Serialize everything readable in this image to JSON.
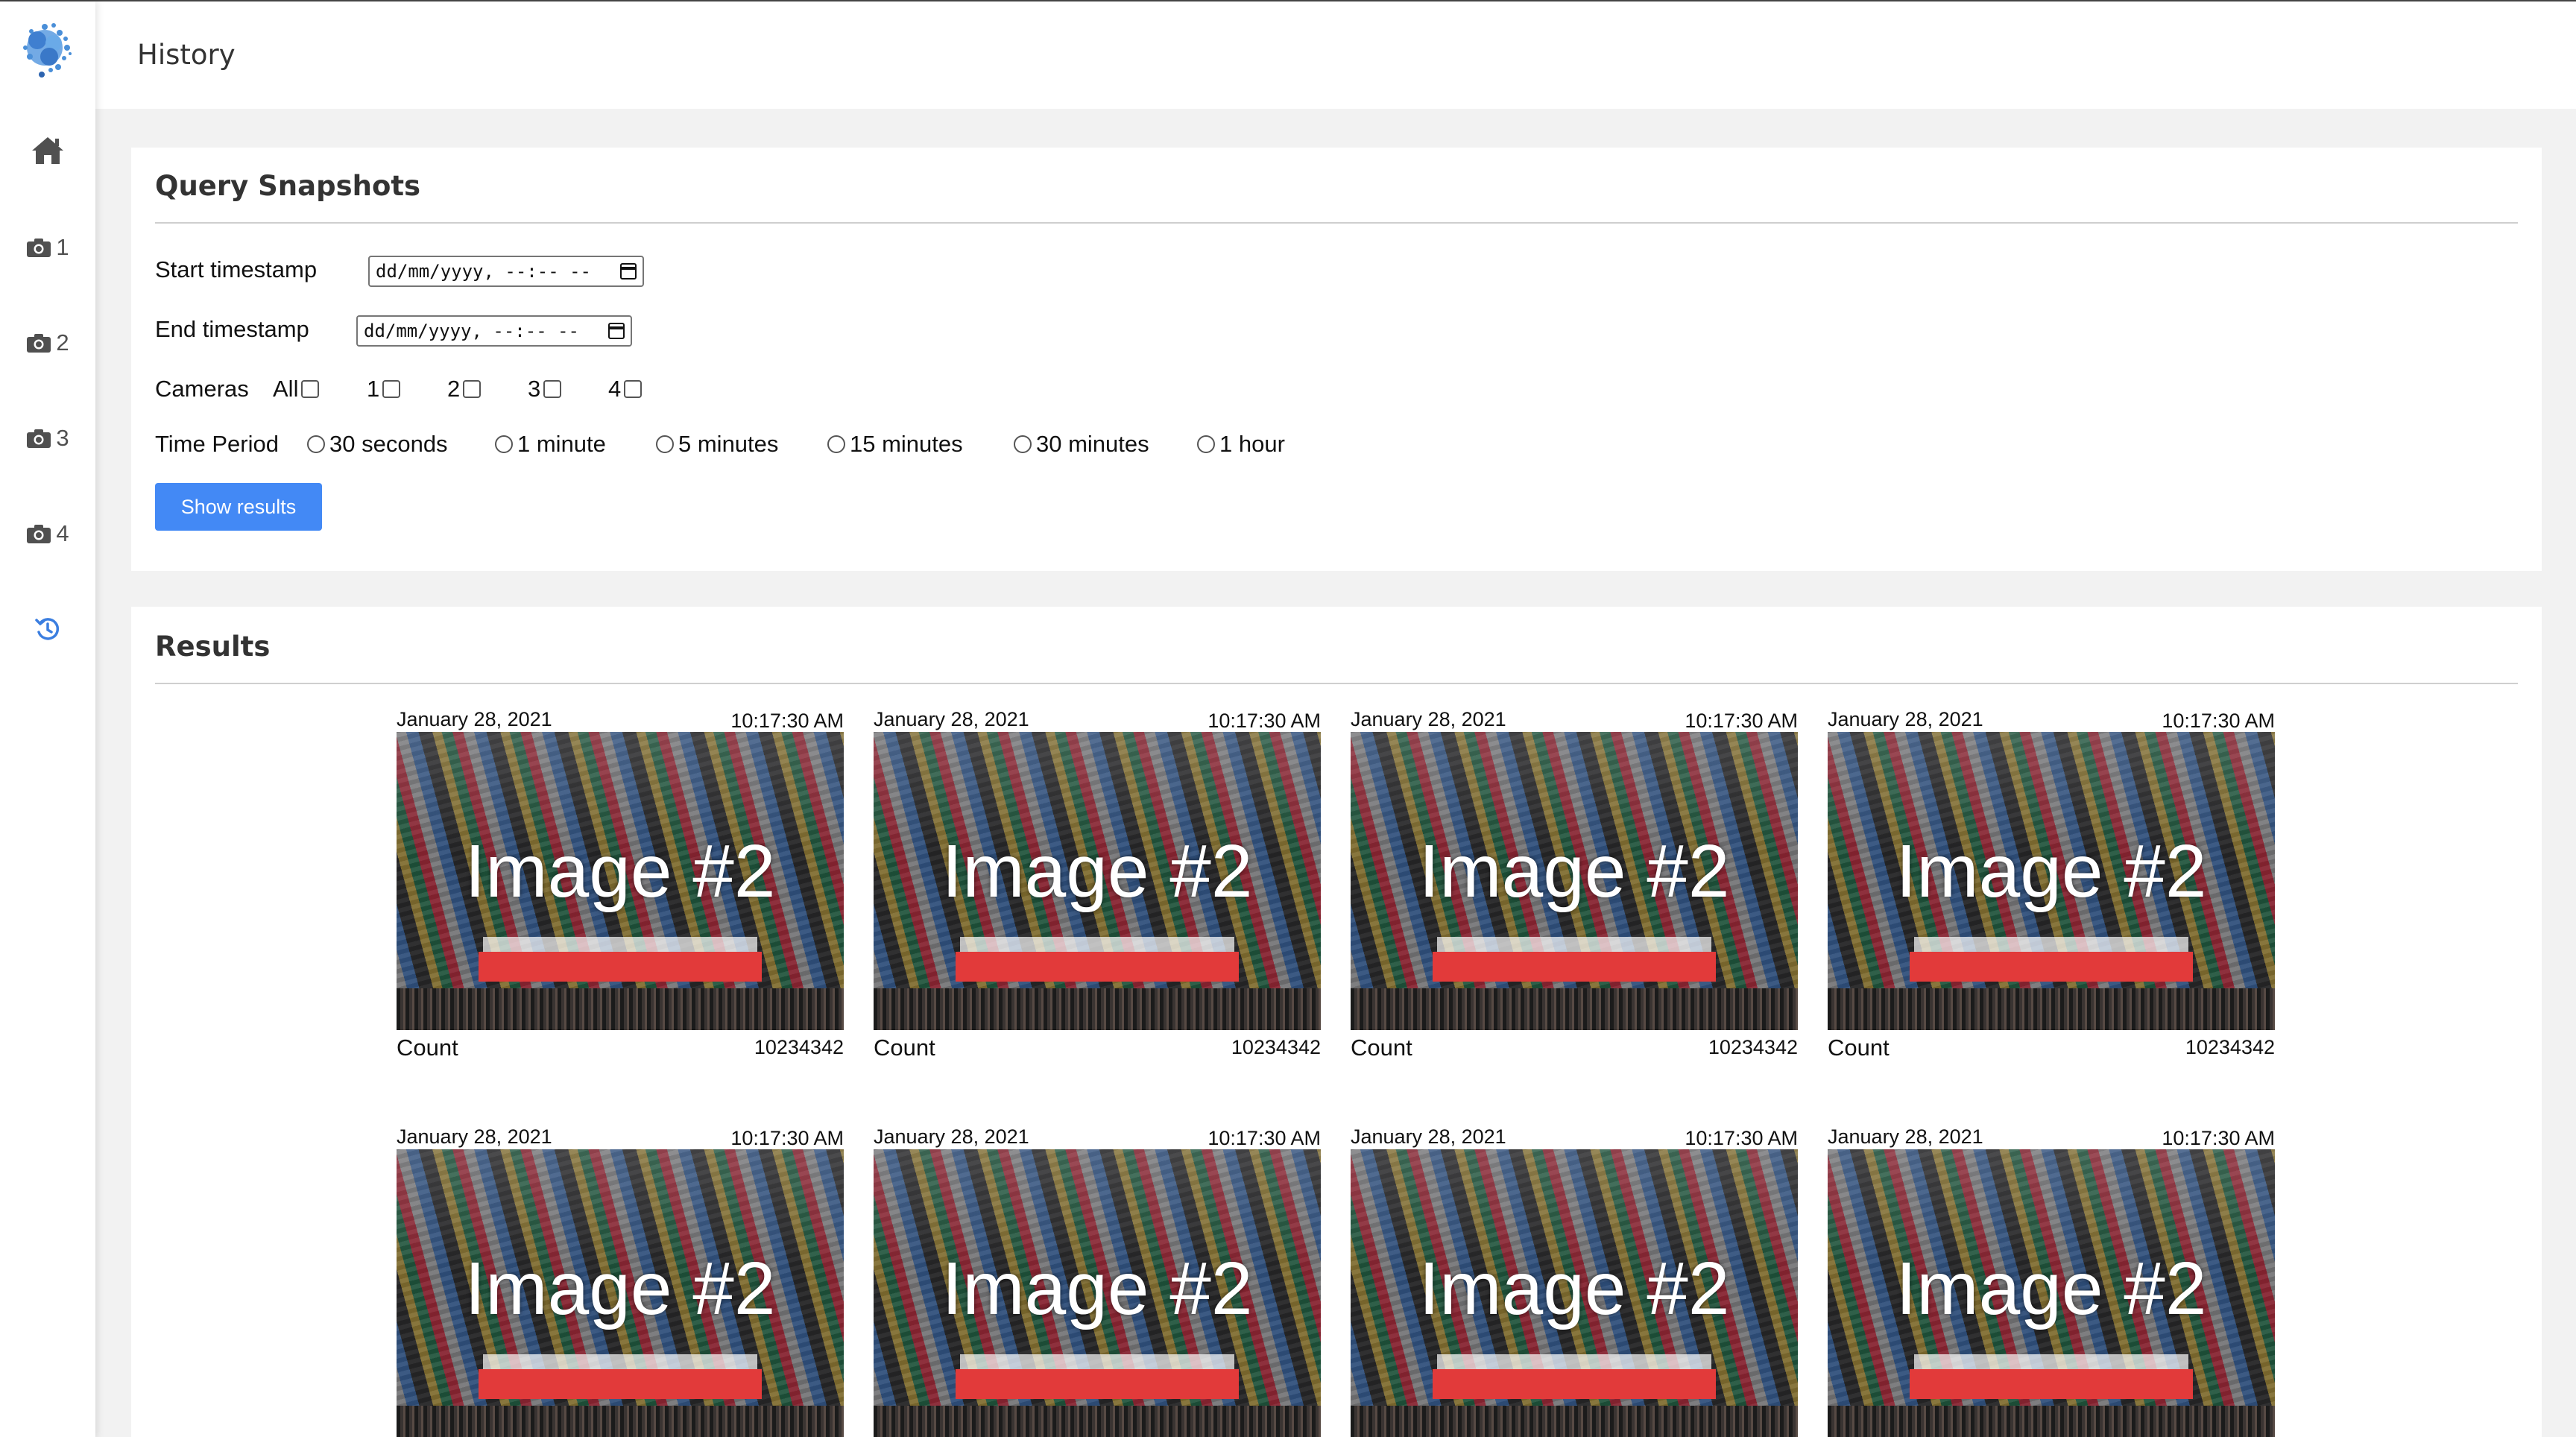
{
  "header": {
    "title": "History"
  },
  "sidebar": {
    "logo_icon": "brain-logo",
    "items": [
      {
        "icon": "home-icon",
        "label": ""
      },
      {
        "icon": "camera-icon",
        "label": "1"
      },
      {
        "icon": "camera-icon",
        "label": "2"
      },
      {
        "icon": "camera-icon",
        "label": "3"
      },
      {
        "icon": "camera-icon",
        "label": "4"
      },
      {
        "icon": "history-icon",
        "label": "",
        "active": true
      }
    ]
  },
  "query": {
    "title": "Query Snapshots",
    "start_label": "Start timestamp",
    "start_value": "dd/mm/yyyy, --:-- --",
    "end_label": "End timestamp",
    "end_value": "dd/mm/yyyy, --:-- --",
    "cameras_label": "Cameras",
    "camera_options": [
      "All",
      "1",
      "2",
      "3",
      "4"
    ],
    "period_label": "Time Period",
    "period_options": [
      "30 seconds",
      "1 minute",
      "5 minutes",
      "15 minutes",
      "30 minutes",
      "1 hour"
    ],
    "submit_label": "Show results"
  },
  "results": {
    "title": "Results",
    "items": [
      {
        "date": "January 28, 2021",
        "time": "10:17:30 AM",
        "image_label": "Image #2",
        "count_label": "Count",
        "count": "10234342"
      },
      {
        "date": "January 28, 2021",
        "time": "10:17:30 AM",
        "image_label": "Image #2",
        "count_label": "Count",
        "count": "10234342"
      },
      {
        "date": "January 28, 2021",
        "time": "10:17:30 AM",
        "image_label": "Image #2",
        "count_label": "Count",
        "count": "10234342"
      },
      {
        "date": "January 28, 2021",
        "time": "10:17:30 AM",
        "image_label": "Image #2",
        "count_label": "Count",
        "count": "10234342"
      },
      {
        "date": "January 28, 2021",
        "time": "10:17:30 AM",
        "image_label": "Image #2"
      },
      {
        "date": "January 28, 2021",
        "time": "10:17:30 AM",
        "image_label": "Image #2"
      },
      {
        "date": "January 28, 2021",
        "time": "10:17:30 AM",
        "image_label": "Image #2"
      },
      {
        "date": "January 28, 2021",
        "time": "10:17:30 AM",
        "image_label": "Image #2"
      }
    ]
  },
  "colors": {
    "accent": "#4389f5",
    "active_icon": "#3b7ee0",
    "page_bg": "#f2f2f2"
  }
}
